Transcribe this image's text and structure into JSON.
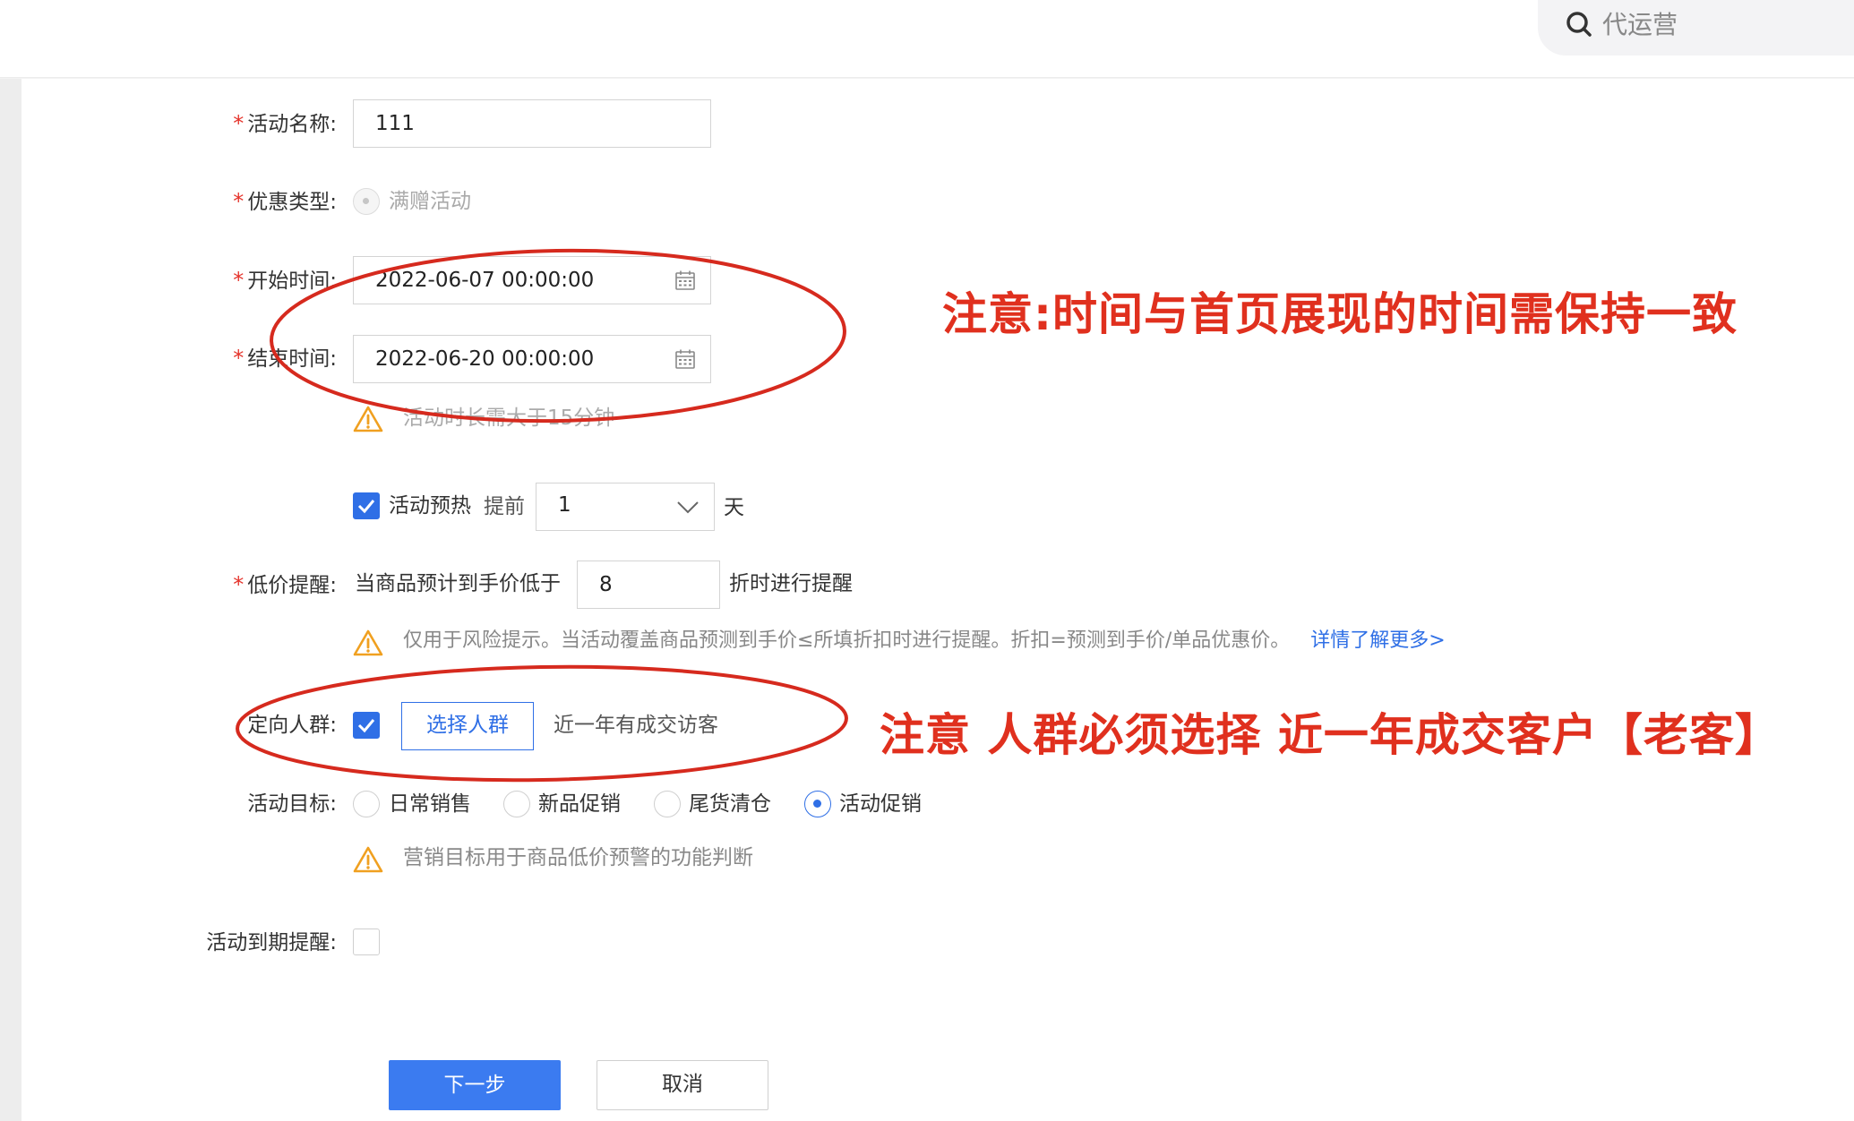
{
  "header": {
    "search_text": "代运营"
  },
  "form": {
    "required_mark": "*",
    "name": {
      "label": "活动名称:",
      "value": "111"
    },
    "discount_type": {
      "label": "优惠类型:",
      "option": "满赠活动"
    },
    "start_time": {
      "label": "开始时间:",
      "value": "2022-06-07 00:00:00"
    },
    "end_time": {
      "label": "结束时间:",
      "value": "2022-06-20 00:00:00"
    },
    "duration_hint": "活动时长需大于15分钟",
    "preheat": {
      "label": "活动预热",
      "prefix": "提前",
      "value": "1",
      "unit": "天",
      "checked": true
    },
    "low_price": {
      "label": "低价提醒:",
      "prefix": "当商品预计到手价低于",
      "value": "8",
      "suffix": "折时进行提醒",
      "hint": "仅用于风险提示。当活动覆盖商品预测到手价≤所填折扣时进行提醒。折扣=预测到手价/单品优惠价。",
      "link": "详情了解更多>"
    },
    "target_crowd": {
      "label": "定向人群:",
      "button": "选择人群",
      "selected": "近一年有成交访客",
      "checked": true
    },
    "goal": {
      "label": "活动目标:",
      "options": [
        "日常销售",
        "新品促销",
        "尾货清仓",
        "活动促销"
      ],
      "selected": "活动促销",
      "hint": "营销目标用于商品低价预警的功能判断"
    },
    "expiry_reminder": {
      "label": "活动到期提醒:",
      "checked": false
    }
  },
  "actions": {
    "next": "下一步",
    "cancel": "取消"
  },
  "annotations": {
    "time_note": "注意:时间与首页展现的时间需保持一致",
    "crowd_note": "注意 人群必须选择 近一年成交客户【老客】",
    "color": "#e0301e"
  },
  "colors": {
    "primary": "#2f6fe6",
    "required": "#e5332b",
    "warning": "#f0a020"
  }
}
